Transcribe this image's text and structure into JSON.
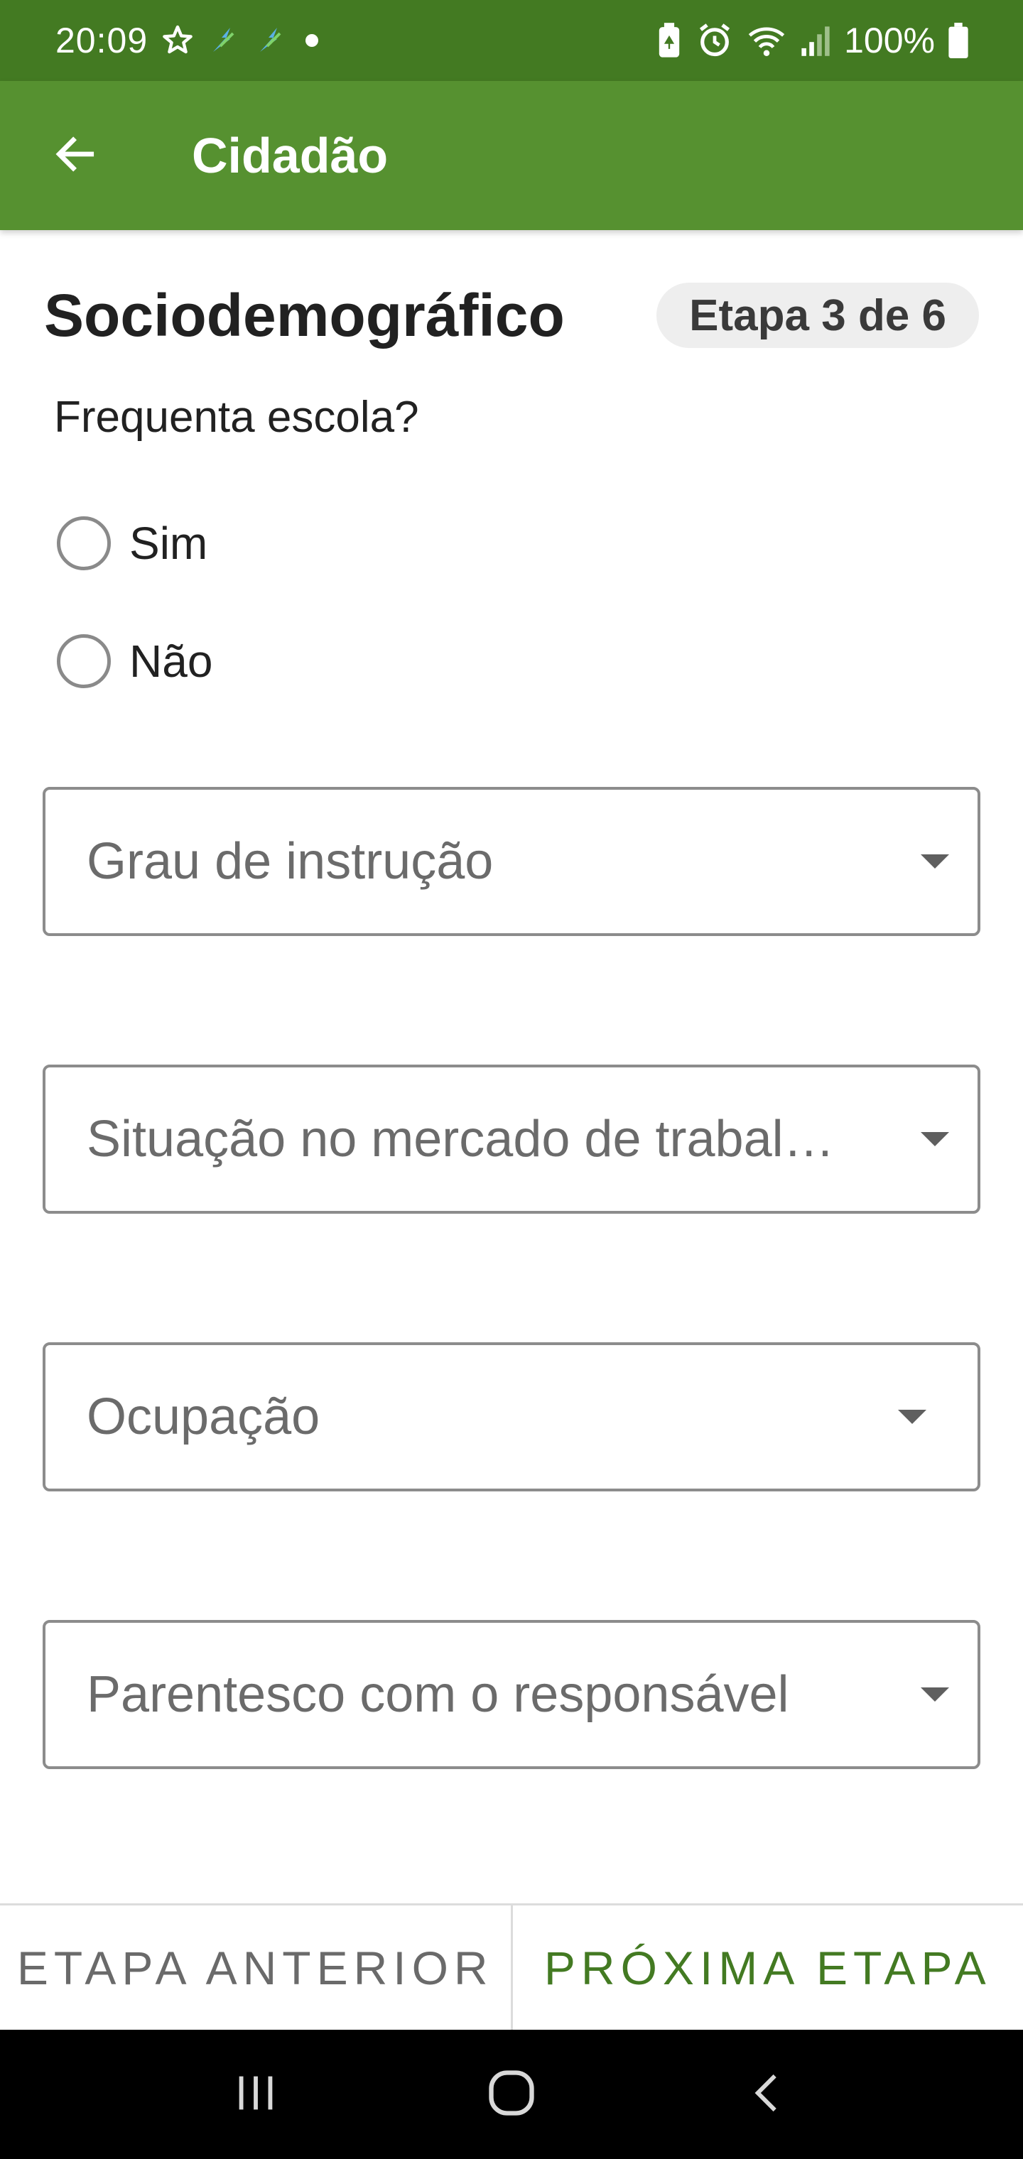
{
  "status_bar": {
    "time": "20:09",
    "battery_percent": "100%",
    "left_icons": [
      "star-icon",
      "bolt-icon",
      "bolt-icon",
      "dot-icon"
    ],
    "right_icons": [
      "battery-saver-icon",
      "alarm-icon",
      "wifi-icon",
      "signal-icon",
      "battery-icon"
    ]
  },
  "app_bar": {
    "title": "Cidadão",
    "back_icon": "arrow-left-icon"
  },
  "section": {
    "title": "Sociodemográfico",
    "step_badge": "Etapa 3 de 6"
  },
  "school_question": {
    "label": "Frequenta escola?",
    "options": [
      {
        "label": "Sim",
        "selected": false
      },
      {
        "label": "Não",
        "selected": false
      }
    ]
  },
  "fields": [
    {
      "placeholder": "Grau de instrução"
    },
    {
      "placeholder": "Situação no mercado de trabal…"
    },
    {
      "placeholder": "Ocupação"
    },
    {
      "placeholder": "Parentesco com o responsável"
    }
  ],
  "actions": {
    "previous": "ETAPA ANTERIOR",
    "next": "PRÓXIMA ETAPA"
  },
  "colors": {
    "status_bar": "#437a22",
    "app_bar": "#569130",
    "accent": "#437a22"
  }
}
